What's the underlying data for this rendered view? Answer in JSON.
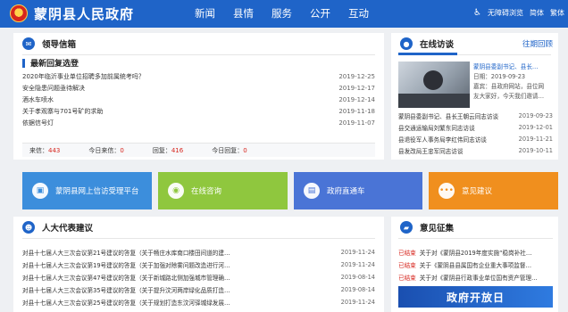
{
  "header": {
    "site_title": "蒙阴县人民政府",
    "nav": [
      "新闻",
      "县情",
      "服务",
      "公开",
      "互动"
    ],
    "util": {
      "accessible": "无障碍浏览",
      "simplified": "简体",
      "traditional": "繁体"
    }
  },
  "mailbox": {
    "title": "领导信箱",
    "subtitle": "最新回复选登",
    "rows": [
      {
        "text": "2020年临沂事业单位招聘多加前属统考吗？",
        "date": "2019-12-25"
      },
      {
        "text": "安全隐患问题亟待解决",
        "date": "2019-12-17"
      },
      {
        "text": "酒水车喷水",
        "date": "2019-12-14"
      },
      {
        "text": "关于孝观寨与701号矿的求助",
        "date": "2019-11-18"
      },
      {
        "text": "依据信号灯",
        "date": "2019-11-07"
      }
    ],
    "stats": {
      "received_label": "来信：",
      "received": "443",
      "today_label": "今日来信：",
      "today": "0",
      "reply_label": "回复：",
      "reply": "416",
      "today_reply_label": "今日回复：",
      "today_reply": "0"
    }
  },
  "interview": {
    "title": "在线访谈",
    "review_tab": "往期回顾",
    "feature": {
      "name": "蒙阴县委副书记、县长…",
      "date": "日期：2019-09-23",
      "guest": "嘉宾：县政府网站，县位网",
      "desc": "友大家好，今天我们邀请…"
    },
    "rows": [
      {
        "text": "蒙阴县委副书记、县长王朝云同志访谈",
        "date": "2019-09-23"
      },
      {
        "text": "县交通运输局刘繁东同志访谈",
        "date": "2019-12-01"
      },
      {
        "text": "县退役军人事务局李红伟同志访谈",
        "date": "2019-11-21"
      },
      {
        "text": "县发改局王忠军同志访谈",
        "date": "2019-10-11"
      }
    ]
  },
  "tiles": [
    {
      "label": "蒙阴县网上信访受理平台",
      "color": "#3c8edc"
    },
    {
      "label": "在线咨询",
      "color": "#8fc73e"
    },
    {
      "label": "政府直通车",
      "color": "#4a74d6"
    },
    {
      "label": "意见建议",
      "color": "#f08f1e"
    }
  ],
  "suggestions": {
    "title": "人大代表建议",
    "rows": [
      {
        "text": "对县十七届人大三次会议第21号建议的答复（关于畅庄水库南口楼田间道的建…",
        "date": "2019-11-24"
      },
      {
        "text": "对县十七届人大三次会议第19号建议的答复（关于加强对除雾问题改造进行河…",
        "date": "2019-11-24"
      },
      {
        "text": "对县十七届人大三次会议第47号建议的答复（关于新城路北侧加强城市管理确…",
        "date": "2019-08-14"
      },
      {
        "text": "对县十七届人大三次会议第35号建议的答复（关于提升汶河两岸绿化品质打造…",
        "date": "2019-08-14"
      },
      {
        "text": "对县十七届人大三次会议第25号建议的答复（关于规划打造东汶河驿城绿发展…",
        "date": "2019-11-24"
      }
    ]
  },
  "opinions": {
    "title": "意见征集",
    "rows": [
      {
        "tag": "已结束",
        "text": "关于对《蒙阴县2019年度实施“稳岗补社…"
      },
      {
        "tag": "已结束",
        "text": "关于《蒙阴县县属国有企业重大事项监督…"
      },
      {
        "tag": "已结束",
        "text": "关于对《蒙阴县行政事业单位国有资产管理…"
      }
    ],
    "banner": "政府开放日"
  }
}
